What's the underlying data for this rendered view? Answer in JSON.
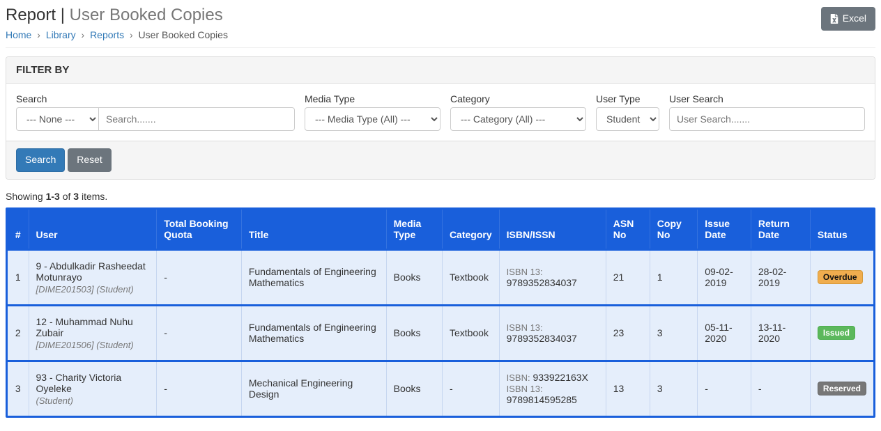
{
  "header": {
    "title_main": "Report",
    "title_sep": " | ",
    "title_sub": "User Booked Copies",
    "excel_label": "Excel"
  },
  "breadcrumb": {
    "home": "Home",
    "library": "Library",
    "reports": "Reports",
    "active": "User Booked Copies",
    "sep": "›"
  },
  "filter": {
    "heading": "FILTER BY",
    "search_label": "Search",
    "search_select_none": "--- None ---",
    "search_placeholder": "Search.......",
    "media_type_label": "Media Type",
    "media_type_all": "--- Media Type (All) ---",
    "category_label": "Category",
    "category_all": "--- Category (All) ---",
    "user_type_label": "User Type",
    "user_type_value": "Student",
    "user_search_label": "User Search",
    "user_search_placeholder": "User Search.......",
    "search_btn": "Search",
    "reset_btn": "Reset"
  },
  "summary": {
    "prefix": "Showing ",
    "range": "1-3",
    "mid": " of ",
    "total": "3",
    "suffix": " items."
  },
  "columns": {
    "idx": "#",
    "user": "User",
    "quota": "Total Booking Quota",
    "title": "Title",
    "media_type": "Media Type",
    "category": "Category",
    "isbn": "ISBN/ISSN",
    "asn": "ASN No",
    "copy": "Copy No",
    "issue": "Issue Date",
    "return": "Return Date",
    "status": "Status"
  },
  "labels": {
    "isbn": "ISBN:",
    "isbn13": "ISBN 13:"
  },
  "status_labels": {
    "overdue": "Overdue",
    "issued": "Issued",
    "reserved": "Reserved"
  },
  "rows": [
    {
      "idx": "1",
      "user_line1": "9 - Abdulkadir Rasheedat Motunrayo",
      "user_line2": "[DIME201503] (Student)",
      "quota": "-",
      "title": "Fundamentals of Engineering Mathematics",
      "media_type": "Books",
      "category": "Textbook",
      "isbn": "",
      "isbn13": "9789352834037",
      "asn": "21",
      "copy": "1",
      "issue": "09-02-2019",
      "return": "28-02-2019",
      "status_key": "overdue"
    },
    {
      "idx": "2",
      "user_line1": "12 - Muhammad Nuhu Zubair",
      "user_line2": "[DIME201506] (Student)",
      "quota": "-",
      "title": "Fundamentals of Engineering Mathematics",
      "media_type": "Books",
      "category": "Textbook",
      "isbn": "",
      "isbn13": "9789352834037",
      "asn": "23",
      "copy": "3",
      "issue": "05-11-2020",
      "return": "13-11-2020",
      "status_key": "issued"
    },
    {
      "idx": "3",
      "user_line1": "93 - Charity Victoria Oyeleke",
      "user_line2": "(Student)",
      "quota": "-",
      "title": "Mechanical Engineering Design",
      "media_type": "Books",
      "category": "-",
      "isbn": "933922163X",
      "isbn13": "9789814595285",
      "asn": "13",
      "copy": "3",
      "issue": "-",
      "return": "-",
      "status_key": "reserved"
    }
  ]
}
